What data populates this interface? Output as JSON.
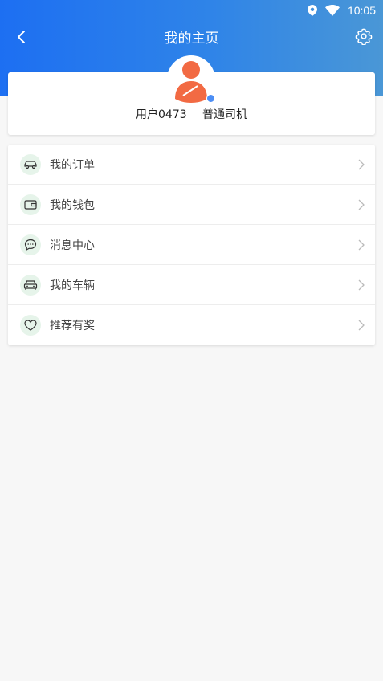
{
  "status_bar": {
    "time": "10:05"
  },
  "nav": {
    "title": "我的主页"
  },
  "profile": {
    "user_name": "用户0473",
    "role": "普通司机"
  },
  "menu": {
    "items": [
      {
        "label": "我的订单",
        "icon": "car-icon"
      },
      {
        "label": "我的钱包",
        "icon": "wallet-icon"
      },
      {
        "label": "消息中心",
        "icon": "message-icon"
      },
      {
        "label": "我的车辆",
        "icon": "vehicle-icon"
      },
      {
        "label": "推荐有奖",
        "icon": "heart-icon"
      }
    ]
  },
  "colors": {
    "header_gradient_start": "#1d6ff2",
    "header_gradient_end": "#4a97d6",
    "avatar": "#f26a43",
    "icon_bg": "#e6f4ea",
    "background": "#f7f7f7"
  }
}
